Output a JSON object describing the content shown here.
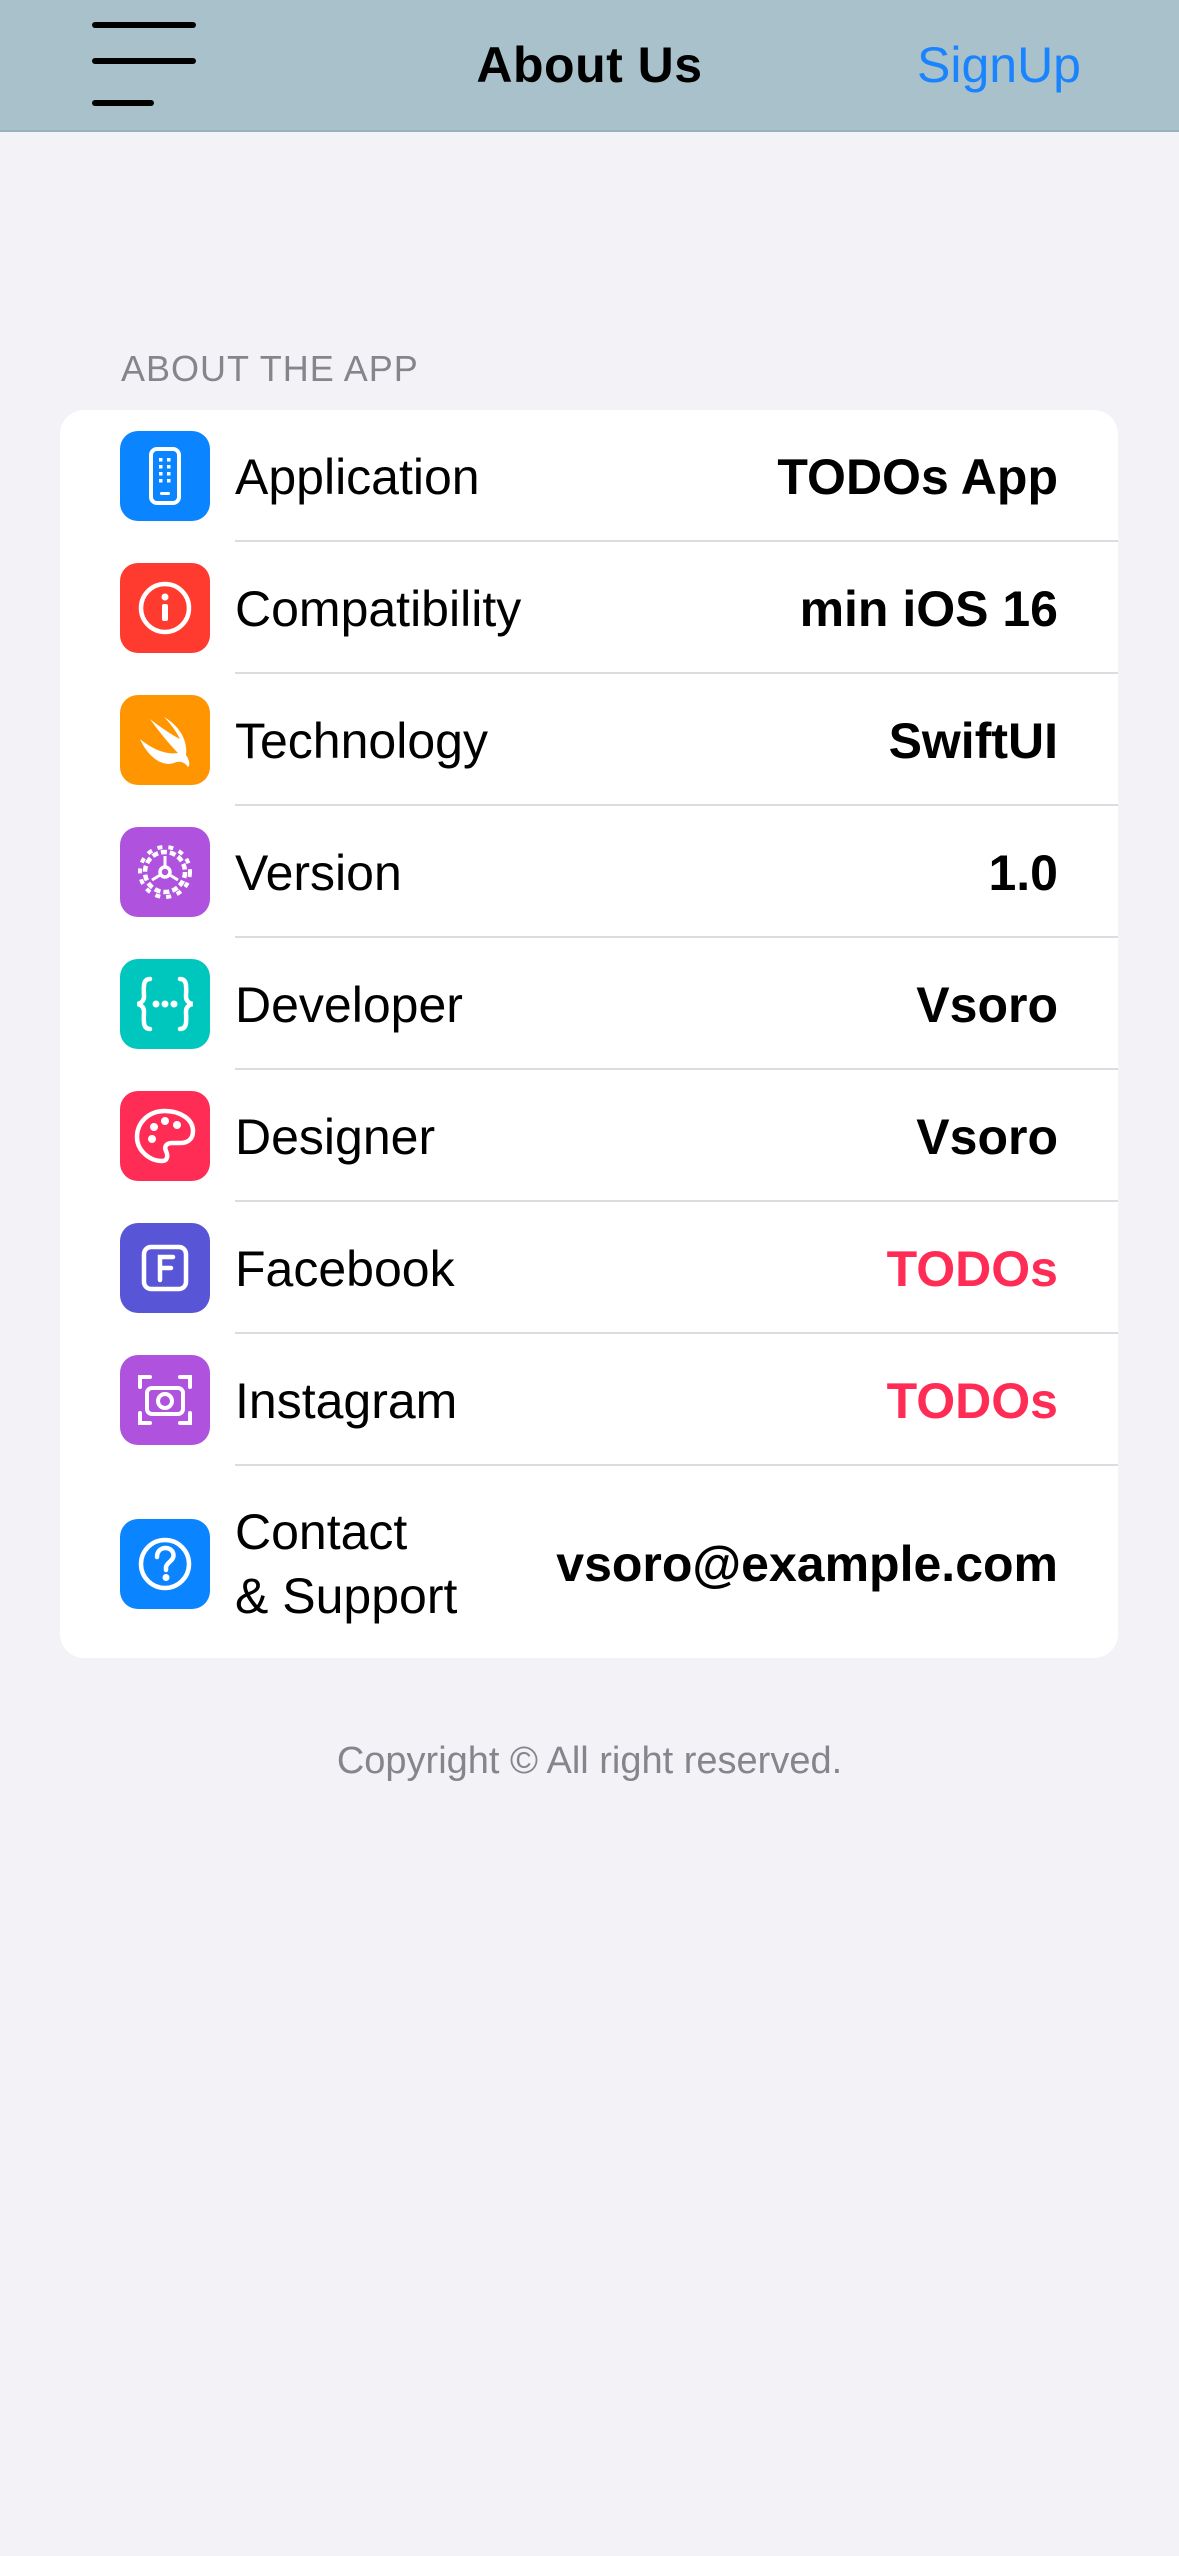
{
  "nav": {
    "title": "About Us",
    "action_label": "SignUp",
    "menu_icon": "hamburger-menu-icon"
  },
  "section": {
    "header": "ABOUT THE APP"
  },
  "rows": [
    {
      "label": "Application",
      "value": "TODOs App",
      "icon": "iphone-icon",
      "color": "#0a84ff",
      "link": false
    },
    {
      "label": "Compatibility",
      "value": "min iOS 16",
      "icon": "info-icon",
      "color": "#ff3b30",
      "link": false
    },
    {
      "label": "Technology",
      "value": "SwiftUI",
      "icon": "swift-icon",
      "color": "#ff9500",
      "link": false
    },
    {
      "label": "Version",
      "value": "1.0",
      "icon": "gear-icon",
      "color": "#af52de",
      "link": false
    },
    {
      "label": "Developer",
      "value": "Vsoro",
      "icon": "ellipsis-curlybraces-icon",
      "color": "#00c7be",
      "link": false
    },
    {
      "label": "Designer",
      "value": "Vsoro",
      "icon": "paintpalette-icon",
      "color": "#ff2d55",
      "link": false
    },
    {
      "label": "Facebook",
      "value": "TODOs",
      "icon": "f-square-icon",
      "color": "#5856d6",
      "link": true
    },
    {
      "label": "Instagram",
      "value": "TODOs",
      "icon": "camera-viewfinder-icon",
      "color": "#af52de",
      "link": true
    },
    {
      "label_line1": "Contact",
      "label_line2": "& Support",
      "value": "vsoro@example.com",
      "icon": "questionmark-circle-icon",
      "color": "#0a84ff",
      "link": false
    }
  ],
  "footer": {
    "text": "Copyright © All right reserved."
  },
  "colors": {
    "navbar_bg": "#a9c1cb",
    "page_bg": "#f2f2f7",
    "link_blue": "#1a84ff",
    "link_pink": "#ff2d55",
    "secondary_text": "#85858b"
  }
}
